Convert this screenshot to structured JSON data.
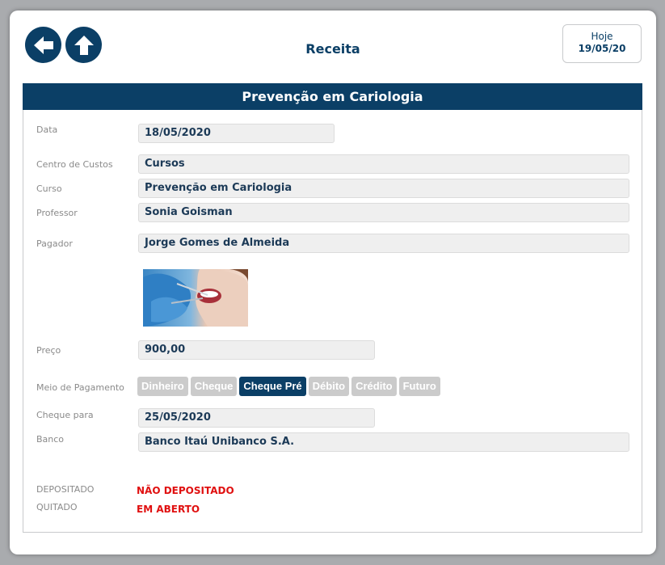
{
  "header": {
    "title": "Receita",
    "today_label": "Hoje",
    "today_date": "19/05/20"
  },
  "panel": {
    "title": "Prevenção em Cariologia"
  },
  "form": {
    "data_label": "Data",
    "data_value": "18/05/2020",
    "centro_label": "Centro de Custos",
    "centro_value": "Cursos",
    "curso_label": "Curso",
    "curso_value": "Prevenção em Cariologia",
    "professor_label": "Professor",
    "professor_value": "Sonia Goisman",
    "pagador_label": "Pagador",
    "pagador_value": "Jorge Gomes de Almeida",
    "preco_label": "Preço",
    "preco_value": "900,00",
    "meio_label": "Meio de Pagamento",
    "payment_options": [
      "Dinheiro",
      "Cheque",
      "Cheque Pré",
      "Débito",
      "Crédito",
      "Futuro"
    ],
    "payment_selected": "Cheque Pré",
    "cheque_label": "Cheque para",
    "cheque_value": "25/05/2020",
    "banco_label": "Banco",
    "banco_value": "Banco Itaú Unibanco S.A."
  },
  "status": {
    "depositado_label": "DEPOSITADO",
    "depositado_value": "NÃO DEPOSITADO",
    "quitado_label": "QUITADO",
    "quitado_value": "EM ABERTO"
  },
  "colors": {
    "accent": "#0b3f66",
    "status_red": "#e01010",
    "inactive_button": "#cbcbcb"
  },
  "icons": {
    "back": "arrow-left-icon",
    "home": "arrow-up-icon"
  }
}
